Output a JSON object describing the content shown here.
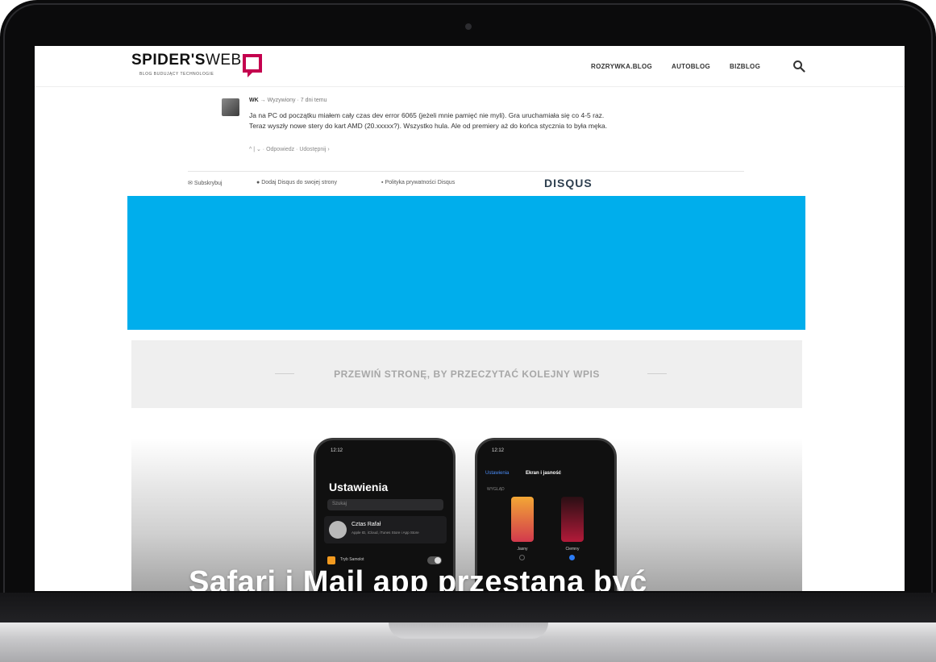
{
  "header": {
    "logo_text": "SPIDER'S",
    "logo_text_web": "WEB",
    "logo_tagline": "BLOG BUDUJĄCY TECHNOLOGIE",
    "nav": [
      "ROZRYWKA.BLOG",
      "AUTOBLOG",
      "BIZBLOG"
    ],
    "search_icon": "search-icon"
  },
  "comment": {
    "author": "WK",
    "reply_to": "→ Wyzywiony",
    "time": "· 7 dni temu",
    "body": "Ja na PC od początku miałem cały czas dev error 6065 (jeżeli mnie pamięć nie myli). Gra uruchamiała się co 4-5 raz. Teraz wyszły nowe stery do kart AMD (20.xxxxx?). Wszystko hula. Ale od premiery aż do końca stycznia to była męka.",
    "actions": "^ | ⌄ · Odpowiedz · Udostępnij ›"
  },
  "disqus": {
    "subscribe": "Subskrybuj",
    "add": "Dodaj Disqus do swojej strony",
    "privacy": "Polityka prywatności Disqus",
    "logo": "DISQUS"
  },
  "ad": {
    "color": "#00aeec"
  },
  "scroll_banner": {
    "text": "PRZEWIŃ STRONĘ, BY PRZECZYTAĆ KOLEJNY WPIS"
  },
  "article": {
    "headline": "Safari i Mail app przestaną być",
    "phone1": {
      "time": "12:12",
      "title": "Ustawienia",
      "search": "Szukaj",
      "user_name": "Cztas Rafał",
      "user_sub": "Apple ID, iCloud, iTunes Store i App Store",
      "setting": "Tryb Samolot"
    },
    "phone2": {
      "time": "12:12",
      "back": "Ustawienia",
      "title": "Ekran i jasność",
      "section": "WYGLĄD",
      "light_label": "Jasny",
      "dark_label": "Ciemny"
    }
  }
}
